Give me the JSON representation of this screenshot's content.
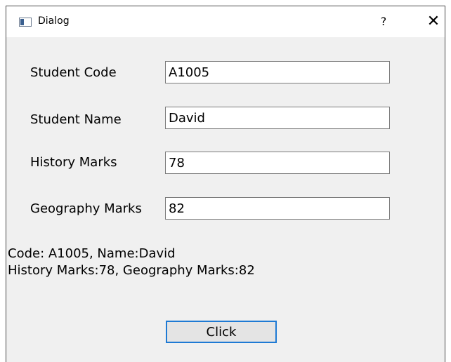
{
  "window": {
    "title": "Dialog",
    "help_label": "?",
    "close_label": "✕"
  },
  "form": {
    "fields": [
      {
        "label": "Student Code",
        "value": "A1005"
      },
      {
        "label": "Student Name",
        "value": "David"
      },
      {
        "label": "History Marks",
        "value": "78"
      },
      {
        "label": "Geography Marks",
        "value": "82"
      }
    ]
  },
  "output": {
    "line1": "Code: A1005, Name:David",
    "line2": "History Marks:78, Geography Marks:82"
  },
  "button": {
    "label": "Click"
  },
  "colors": {
    "window_bg": "#f0f0f0",
    "titlebar_bg": "#ffffff",
    "button_focus_border": "#1e7ad4"
  }
}
